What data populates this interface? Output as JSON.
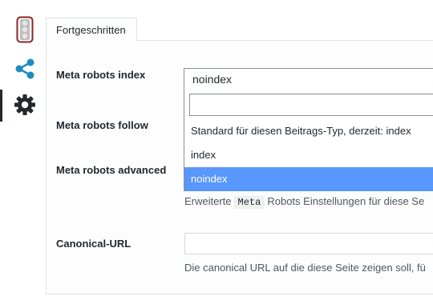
{
  "rail": {
    "icons": [
      "traffic-light-icon",
      "share-icon",
      "gear-icon"
    ]
  },
  "tab": {
    "label": "Fortgeschritten"
  },
  "fields": {
    "meta_robots_index": {
      "label": "Meta robots index",
      "value": "noindex"
    },
    "meta_robots_follow": {
      "label": "Meta robots follow"
    },
    "meta_robots_advanced": {
      "label": "Meta robots advanced",
      "description_prefix": "Erweiterte",
      "description_code": "Meta",
      "description_suffix": "Robots Einstellungen für diese Se"
    },
    "canonical_url": {
      "label": "Canonical-URL",
      "value": "",
      "description": "Die canonical URL auf die diese Seite zeigen soll, fü"
    }
  },
  "dropdown": {
    "search_value": "",
    "options": [
      {
        "label": "Standard für diesen Beitrags-Typ, derzeit: index",
        "selected": false
      },
      {
        "label": "index",
        "selected": false
      },
      {
        "label": "noindex",
        "selected": true
      }
    ]
  },
  "colors": {
    "selected_option": "#5897fb",
    "accent_blue": "#1e8cbe",
    "traffic_light_border": "#8a2424"
  }
}
